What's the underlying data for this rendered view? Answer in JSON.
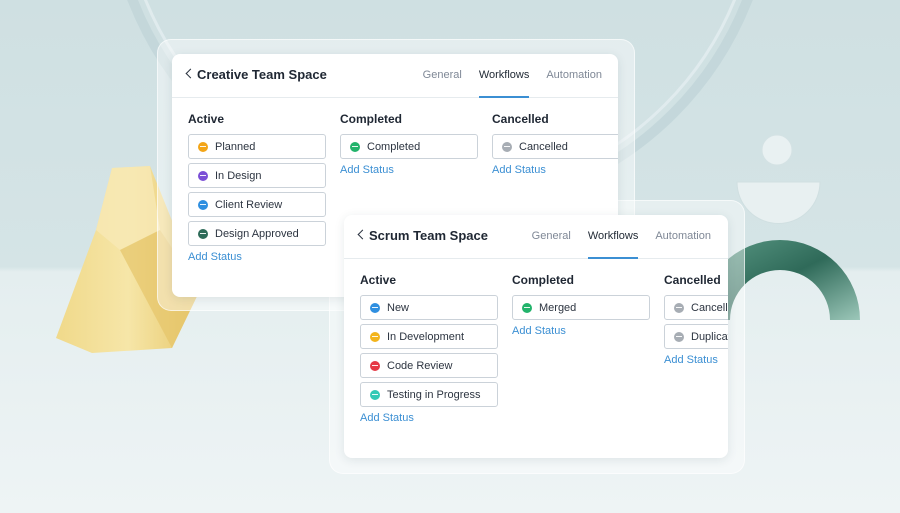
{
  "colors": {
    "accent": "#3b8fd3",
    "planned": "#f3a517",
    "in_design": "#7b4fd6",
    "client_review": "#2f8fe0",
    "design_approved": "#2e6b58",
    "completed": "#22b36b",
    "cancelled": "#a7adb4",
    "new": "#2f8fe0",
    "in_development": "#f3b41b",
    "code_review": "#e53945",
    "testing": "#33c9b6",
    "merged": "#22b36b"
  },
  "creative": {
    "title": "Creative Team Space",
    "tabs": [
      "General",
      "Workflows",
      "Automation"
    ],
    "active": {
      "title": "Active",
      "statuses": [
        "Planned",
        "In Design",
        "Client Review",
        "Design Approved"
      ],
      "add": "Add Status"
    },
    "completed": {
      "title": "Completed",
      "statuses": [
        "Completed"
      ],
      "add": "Add Status"
    },
    "cancelled": {
      "title": "Cancelled",
      "statuses": [
        "Cancelled"
      ],
      "add": "Add Status"
    }
  },
  "scrum": {
    "title": "Scrum Team Space",
    "tabs": [
      "General",
      "Workflows",
      "Automation"
    ],
    "active": {
      "title": "Active",
      "statuses": [
        "New",
        "In Development",
        "Code Review",
        "Testing in Progress"
      ],
      "add": "Add Status"
    },
    "completed": {
      "title": "Completed",
      "statuses": [
        "Merged"
      ],
      "add": "Add Status"
    },
    "cancelled": {
      "title": "Cancelled",
      "statuses": [
        "Cancelled",
        "Duplicate"
      ],
      "add": "Add Status"
    }
  }
}
